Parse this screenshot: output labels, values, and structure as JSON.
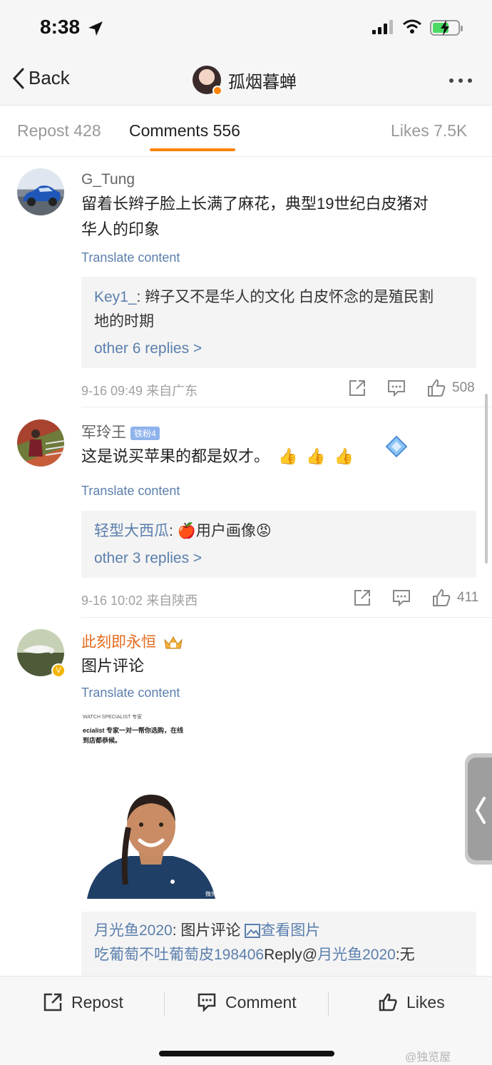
{
  "status": {
    "time": "8:38"
  },
  "nav": {
    "back_label": "Back",
    "title": "孤烟暮蝉"
  },
  "tabs": [
    {
      "label": "Repost 428"
    },
    {
      "label": "Comments 556"
    },
    {
      "label": "Likes 7.5K"
    }
  ],
  "comments": [
    {
      "user": "G_Tung",
      "text_line1": "留着长辫子脸上长满了麻花，典型19世纪白皮猪对",
      "text_line2": "华人的印象",
      "translate": "Translate content",
      "reply": {
        "user": "Key1_",
        "sep": ": ",
        "text_line1": "辫子又不是华人的文化 白皮怀念的是殖民割",
        "text_line2": "地的时期",
        "more": "other 6 replies >"
      },
      "meta": "9-16 09:49  来自广东",
      "likes": "508"
    },
    {
      "user": "军玲王",
      "badge": "铁粉4",
      "text": "这是说买苹果的都是奴才。",
      "emojis": [
        "👍",
        "👍",
        "👍"
      ],
      "translate": "Translate content",
      "reply": {
        "user": "轻型大西瓜",
        "sep": ": ",
        "apple": "🍎",
        "text": "用户画像",
        "face": "😡",
        "more": "other 3 replies >"
      },
      "meta": "9-16 10:02  来自陕西",
      "likes": "411"
    },
    {
      "user": "此刻即永恒",
      "text": "图片评论",
      "translate": "Translate content",
      "image_caption_line0": "WATCH SPECIALIST 专家",
      "image_caption_line1": "ecialist 专家一对一帮你选购，在线",
      "image_caption_line2": "到店都恭候。",
      "image_watermark": "微博",
      "reply_line1": {
        "user": "月光鱼2020",
        "sep": ": ",
        "text": "图片评论 ",
        "link": "查看图片"
      },
      "reply_line2": {
        "user": "吃葡萄不吐葡萄皮198406",
        "mid": "Reply@",
        "user2": "月光鱼2020",
        "sep": ":",
        "text": "无"
      }
    }
  ],
  "bottom_bar": {
    "repost": "Repost",
    "comment": "Comment",
    "likes": "Likes"
  },
  "watermark": "@独览屋",
  "colors": {
    "accent": "#ff8200",
    "link": "#5b7fad"
  }
}
